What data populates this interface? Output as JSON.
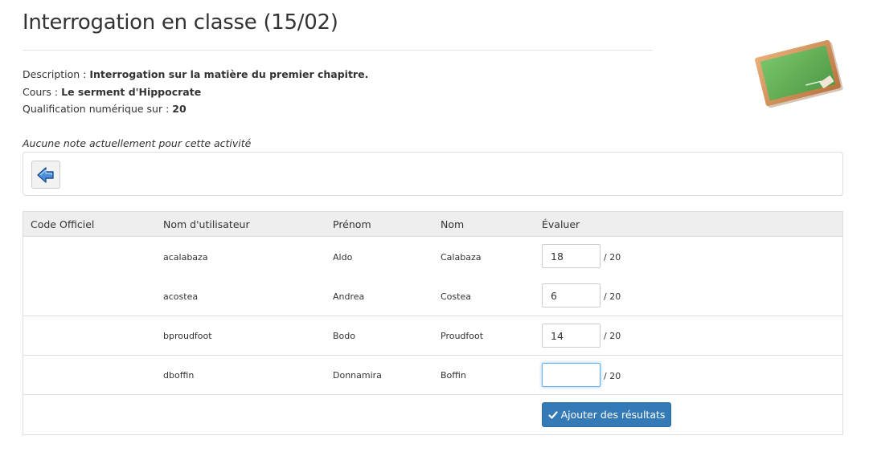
{
  "page": {
    "title": "Interrogation en classe (15/02)"
  },
  "meta": {
    "description_label": "Description : ",
    "description_value": "Interrogation sur la matière du premier chapitre.",
    "course_label": "Cours : ",
    "course_value": "Le serment d'Hippocrate",
    "qualification_label": "Qualification numérique sur : ",
    "qualification_value": "20"
  },
  "notice": "Aucune note actuellement pour cette activité",
  "table": {
    "headers": [
      "Code Officiel",
      "Nom d'utilisateur",
      "Prénom",
      "Nom",
      "Évaluer"
    ],
    "rows": [
      {
        "code": "",
        "username": "acalabaza",
        "first_name": "Aldo",
        "last_name": "Calabaza",
        "grade": "18",
        "max": "/ 20"
      },
      {
        "code": "",
        "username": "acostea",
        "first_name": "Andrea",
        "last_name": "Costea",
        "grade": "6",
        "max": "/ 20"
      },
      {
        "code": "",
        "username": "bproudfoot",
        "first_name": "Bodo",
        "last_name": "Proudfoot",
        "grade": "14",
        "max": "/ 20"
      },
      {
        "code": "",
        "username": "dboffin",
        "first_name": "Donnamira",
        "last_name": "Boffin",
        "grade": "",
        "max": "/ 20"
      }
    ]
  },
  "submit_label": "Ajouter des résultats",
  "colors": {
    "primary": "#337ab7",
    "header_bg": "#eeeeee",
    "board_green": "#5aa84f",
    "board_frame": "#c9834a"
  },
  "icons": {
    "back": "back-arrow-icon",
    "submit": "check-icon",
    "illustration": "chalkboard-icon"
  }
}
